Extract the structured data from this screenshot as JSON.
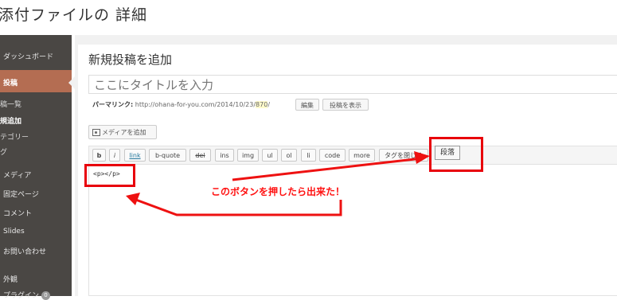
{
  "header": {
    "title": "添付ファイルの 詳細"
  },
  "sidebar": {
    "items": [
      {
        "label": "ダッシュボード"
      },
      {
        "label": "投稿"
      },
      {
        "label": "稿一覧"
      },
      {
        "label": "規追加"
      },
      {
        "label": "テゴリー"
      },
      {
        "label": "グ"
      },
      {
        "label": "メディア"
      },
      {
        "label": "固定ページ"
      },
      {
        "label": "コメント"
      },
      {
        "label": "Slides"
      },
      {
        "label": "お問い合わせ"
      },
      {
        "label": "外観"
      },
      {
        "label": "プラグイン",
        "badge": "0"
      }
    ]
  },
  "main": {
    "heading": "新規投稿を追加",
    "title_placeholder": "ここにタイトルを入力",
    "permalink": {
      "label": "パーマリンク:",
      "url_prefix": "http://ohana-for-you.com/2014/10/23/",
      "url_id": "870",
      "url_suffix": "/",
      "edit_label": "編集",
      "view_label": "投稿を表示"
    },
    "media_button": "メディアを追加",
    "quicktags": [
      "b",
      "i",
      "link",
      "b-quote",
      "del",
      "ins",
      "img",
      "ul",
      "ol",
      "li",
      "code",
      "more",
      "タグを閉じる"
    ],
    "paragraph_button": "段落",
    "editor_content": "<p></p>"
  },
  "annotation": {
    "text": "このボタンを押したら出来た！",
    "color": "#ff1111"
  }
}
